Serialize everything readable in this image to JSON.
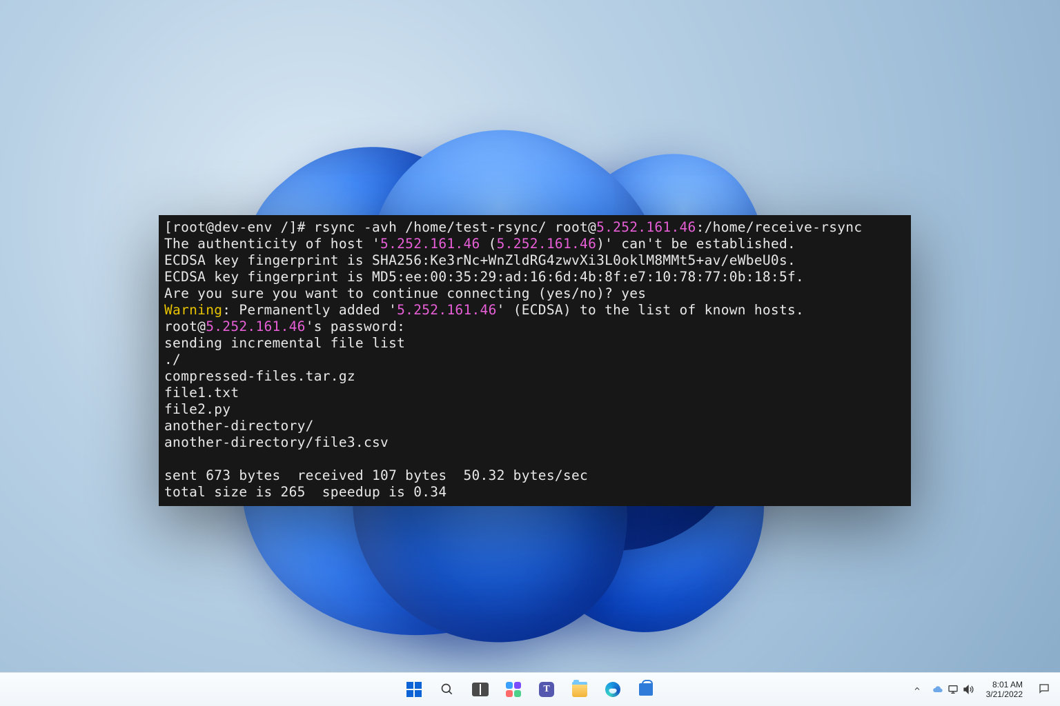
{
  "terminal": {
    "prompt": "[root@dev-env /]# ",
    "command_pre_ip": "rsync -avh /home/test-rsync/ root@",
    "command_ip": "5.252.161.46",
    "command_post_ip": ":/home/receive-rsync",
    "line2_a": "The authenticity of host '",
    "line2_ip1": "5.252.161.46",
    "line2_b": " (",
    "line2_ip2": "5.252.161.46",
    "line2_c": ")' can't be established.",
    "line3": "ECDSA key fingerprint is SHA256:Ke3rNc+WnZldRG4zwvXi3L0oklM8MMt5+av/eWbeU0s.",
    "line4": "ECDSA key fingerprint is MD5:ee:00:35:29:ad:16:6d:4b:8f:e7:10:78:77:0b:18:5f.",
    "line5": "Are you sure you want to continue connecting (yes/no)? yes",
    "line6_warn": "Warning",
    "line6_a": ": Permanently added '",
    "line6_ip": "5.252.161.46",
    "line6_b": "' (ECDSA) to the list of known hosts.",
    "line7_a": "root@",
    "line7_ip": "5.252.161.46",
    "line7_b": "'s password:",
    "line8": "sending incremental file list",
    "line9": "./",
    "line10": "compressed-files.tar.gz",
    "line11": "file1.txt",
    "line12": "file2.py",
    "line13": "another-directory/",
    "line14": "another-directory/file3.csv",
    "line15": "",
    "line16": "sent 673 bytes  received 107 bytes  50.32 bytes/sec",
    "line17": "total size is 265  speedup is 0.34"
  },
  "taskbar": {
    "apps": {
      "start": "Start",
      "search": "Search",
      "taskview": "Task View",
      "widgets": "Widgets",
      "chat": "Chat",
      "explorer": "File Explorer",
      "edge": "Microsoft Edge",
      "store": "Microsoft Store"
    },
    "tray": {
      "chevron": "Show hidden icons",
      "onedrive": "OneDrive",
      "network": "Network",
      "volume": "Volume"
    },
    "clock": {
      "time": "8:01 AM",
      "date": "3/21/2022"
    }
  }
}
